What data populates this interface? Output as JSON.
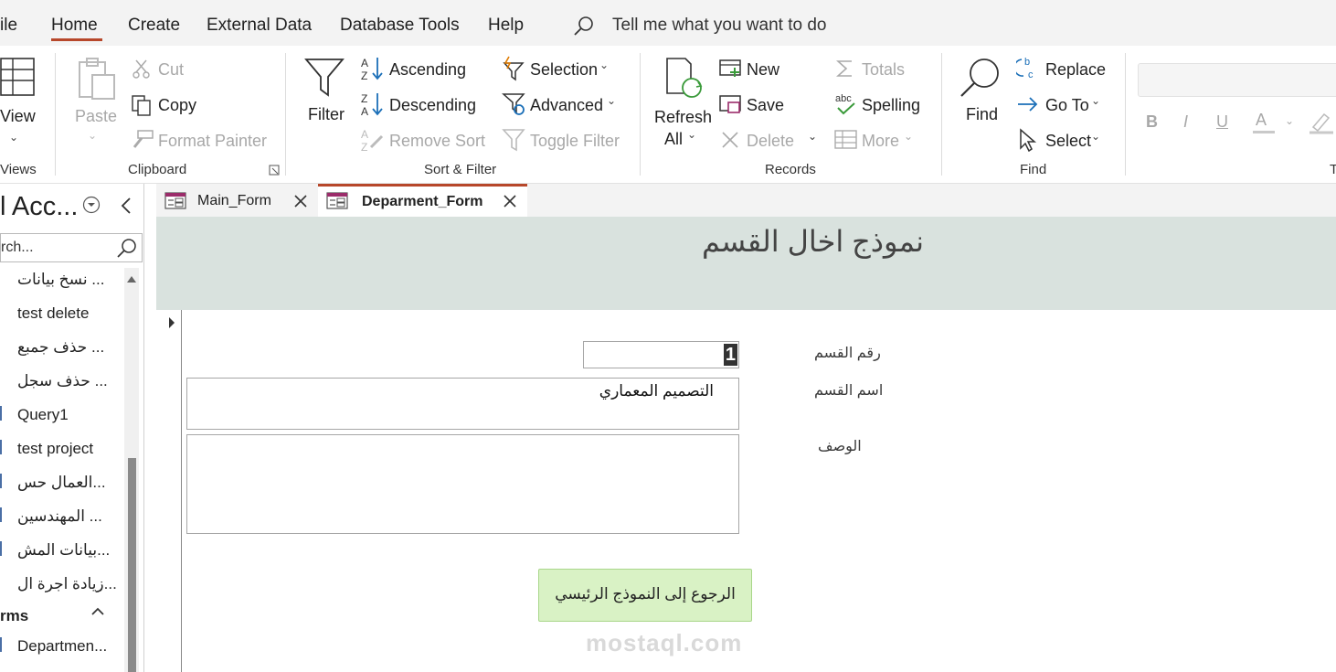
{
  "menubar": {
    "file": "ile",
    "home": "Home",
    "create": "Create",
    "external_data": "External Data",
    "database_tools": "Database Tools",
    "help": "Help",
    "tell_me": "Tell me what you want to do"
  },
  "ribbon": {
    "views": {
      "view": "View",
      "label": "Views"
    },
    "clipboard": {
      "paste": "Paste",
      "cut": "Cut",
      "copy": "Copy",
      "format_painter": "Format Painter",
      "label": "Clipboard"
    },
    "sort_filter": {
      "filter": "Filter",
      "ascending": "Ascending",
      "descending": "Descending",
      "remove_sort": "Remove Sort",
      "selection": "Selection",
      "advanced": "Advanced",
      "toggle_filter": "Toggle Filter",
      "label": "Sort & Filter"
    },
    "records": {
      "refresh": "Refresh",
      "all": "All",
      "new": "New",
      "save": "Save",
      "delete": "Delete",
      "totals": "Totals",
      "spelling": "Spelling",
      "more": "More",
      "label": "Records"
    },
    "find": {
      "find": "Find",
      "replace": "Replace",
      "go_to": "Go To",
      "select": "Select",
      "label": "Find"
    },
    "text_formatting": {
      "bold": "B",
      "italic": "I",
      "underline": "U",
      "font_color": "A",
      "label": "T"
    }
  },
  "nav": {
    "title": "l Acc...",
    "search_placeholder": "rch...",
    "items": [
      "نسخ بيانات ...",
      "test delete",
      "حذف جمبع ...",
      "حذف سجل ...",
      "Query1",
      "test project",
      "العمال حس...",
      "المهندسين ...",
      "بيانات المش...",
      "زيادة اجرة ال..."
    ],
    "section": "rms",
    "forms": [
      "Departmen..."
    ]
  },
  "tabs": [
    {
      "label": "Main_Form"
    },
    {
      "label": "Deparment_Form"
    }
  ],
  "form": {
    "title": "نموذج اخال القسم",
    "dept_no_label": "رقم القسم",
    "dept_no_value": "1",
    "dept_name_label": "اسم القسم",
    "dept_name_value": "التصميم المعماري",
    "desc_label": "الوصف",
    "desc_value": "",
    "back_button": "الرجوع إلى النموذج الرئيسي"
  },
  "watermark": {
    "text": "mostaql.com"
  },
  "colors": {
    "accent": "#b7472a",
    "form_header": "#d9e2de",
    "button_bg": "#d9f2c5"
  }
}
